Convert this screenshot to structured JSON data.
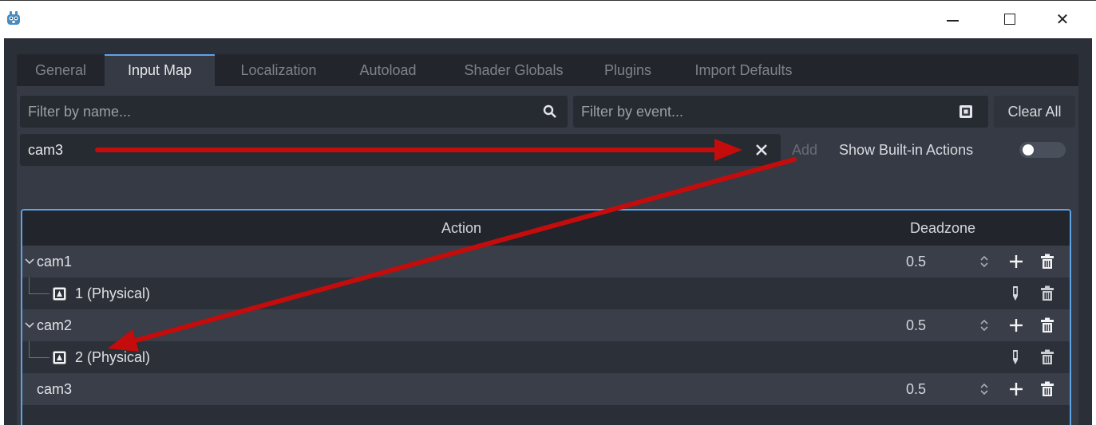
{
  "window": {
    "app_icon": "godot-icon",
    "minimize_icon": "minimize-icon",
    "maximize_icon": "maximize-icon",
    "close_symbol": "✕"
  },
  "tabs": [
    {
      "label": "General"
    },
    {
      "label": "Input Map",
      "active": true
    },
    {
      "label": "Localization"
    },
    {
      "label": "Autoload"
    },
    {
      "label": "Shader Globals"
    },
    {
      "label": "Plugins"
    },
    {
      "label": "Import Defaults"
    }
  ],
  "filters": {
    "name_placeholder": "Filter by name...",
    "event_placeholder": "Filter by event...",
    "search_icon": "search-icon",
    "event_icon": "keyboard-icon",
    "clear_all": "Clear All"
  },
  "add_action": {
    "value": "cam3",
    "clear_icon": "close-icon",
    "add_label": "Add",
    "builtin_label": "Show Built-in Actions",
    "builtin_enabled": false
  },
  "tree": {
    "col_action": "Action",
    "col_deadzone": "Deadzone",
    "rows": [
      {
        "kind": "action",
        "name": "cam1",
        "deadzone": "0.5",
        "expanded": true
      },
      {
        "kind": "event",
        "name": "1 (Physical)"
      },
      {
        "kind": "action",
        "name": "cam2",
        "deadzone": "0.5",
        "expanded": true
      },
      {
        "kind": "event",
        "name": "2 (Physical)"
      },
      {
        "kind": "action",
        "name": "cam3",
        "deadzone": "0.5",
        "expanded": false
      }
    ]
  },
  "colors": {
    "accent": "#5ea3e6",
    "annotation_arrow": "#c40c0c",
    "background": "#2b2f38"
  }
}
